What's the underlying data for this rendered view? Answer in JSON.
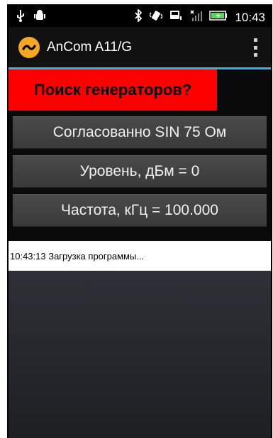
{
  "status_bar": {
    "time": "10:43",
    "icons_left": [
      "usb-icon",
      "android-debug-icon"
    ],
    "icons_right": [
      "bluetooth-icon",
      "vibrate-icon",
      "storage-icon",
      "signal-icon",
      "battery-icon"
    ]
  },
  "action_bar": {
    "title": "AnCom A11/G",
    "logo_icon": "tilde-logo-icon",
    "menu_icon": "overflow-menu-icon",
    "accent_color": "#33b5e5"
  },
  "main": {
    "search_label": "Поиск генераторов?",
    "search_color": "#ff0000",
    "buttons": [
      {
        "label": "Согласованно SIN 75 Ом"
      },
      {
        "label": "Уровень, дБм = 0"
      },
      {
        "label": "Частота, кГц = 100.000"
      }
    ]
  },
  "log": {
    "text": "10:43:13 Загрузка программы..."
  }
}
